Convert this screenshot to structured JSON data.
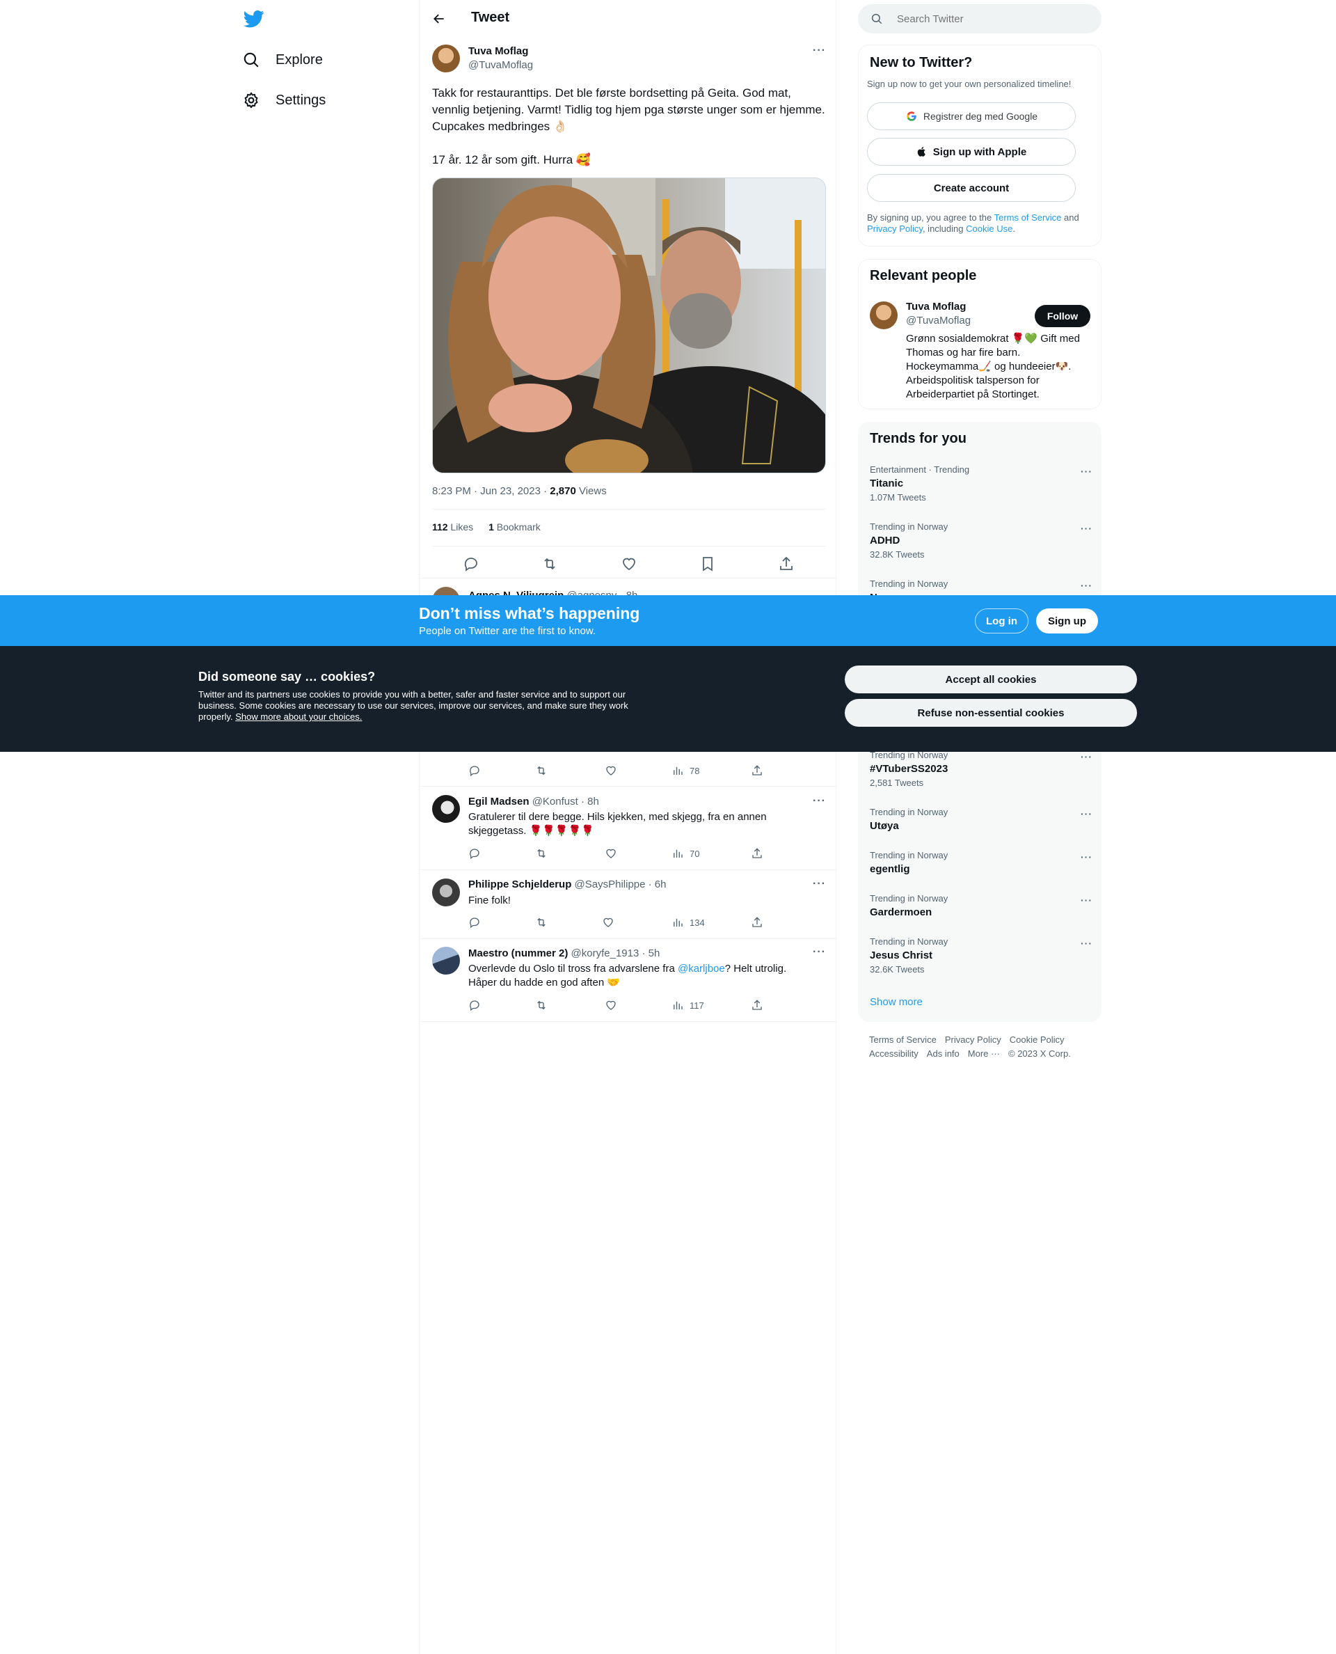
{
  "nav": {
    "explore": "Explore",
    "settings": "Settings"
  },
  "header": {
    "title": "Tweet"
  },
  "main_tweet": {
    "name": "Tuva Moflag",
    "handle": "@TuvaMoflag",
    "text": "Takk for restauranttips. Det ble første bordsetting på Geita. God mat, vennlig betjening. Varmt! Tidlig tog hjem pga største unger som er hjemme. Cupcakes medbringes 👌🏻\n\n17 år. 12 år som gift. Hurra 🥰",
    "time": "8:23 PM · Jun 23, 2023 · ",
    "views": "2,870",
    "views_label": " Views",
    "likes": "112",
    "likes_label": " Likes",
    "bookmarks": "1",
    "bookmarks_label": " Bookmark"
  },
  "partial_reply": {
    "name": "Agnes N. Viljugrein",
    "handle": "@agnesnv · 8h"
  },
  "replies": [
    {
      "name": "Egil Madsen",
      "meta": " @Konfust · 8h",
      "text": "Gratulerer til dere begge. Hils kjekken, med skjegg, fra en annen skjeggetass. 🌹🌹🌹🌹🌹",
      "views": "70"
    },
    {
      "name": "Philippe Schjelderup",
      "meta": " @SaysPhilippe · 6h",
      "text": "Fine folk!",
      "views": "134"
    },
    {
      "name": "Maestro (nummer 2)",
      "meta": " @koryfe_1913 · 5h",
      "text_a": "Overlevde du Oslo til tross fra advarslene fra ",
      "mention": "@karljboe",
      "text_b": "? Helt utrolig. Håper du hadde en god aften 🤝",
      "views": "117"
    }
  ],
  "hidden_reply_views": "78",
  "search": {
    "placeholder": "Search Twitter"
  },
  "signup": {
    "title": "New to Twitter?",
    "sub": "Sign up now to get your own personalized timeline!",
    "google": "Registrer deg med Google",
    "apple": "Sign up with Apple",
    "create": "Create account",
    "legal_a": "By signing up, you agree to the ",
    "tos": "Terms of Service",
    "legal_b": " and ",
    "privacy": "Privacy Policy",
    "legal_c": ", including ",
    "cookie": "Cookie Use",
    "legal_d": "."
  },
  "relevant": {
    "title": "Relevant people",
    "name": "Tuva Moflag",
    "handle": "@TuvaMoflag",
    "follow": "Follow",
    "bio": "Grønn sosialdemokrat 🌹💚 Gift med Thomas og har fire barn. Hockeymamma🏒 og hundeeier🐶. Arbeidspolitisk talsperson for Arbeiderpartiet på Stortinget."
  },
  "trends": {
    "title": "Trends for you",
    "items": [
      {
        "cat": "Entertainment · Trending",
        "name": "Titanic",
        "count": "1.07M Tweets"
      },
      {
        "cat": "Trending in Norway",
        "name": "ADHD",
        "count": "32.8K Tweets"
      },
      {
        "cat": "Trending in Norway",
        "name": "N",
        "count": ""
      },
      {
        "cat": "Trending in Norway",
        "name": "#VTuberSS2023",
        "count": "2,581 Tweets"
      },
      {
        "cat": "Trending in Norway",
        "name": "Utøya",
        "count": ""
      },
      {
        "cat": "Trending in Norway",
        "name": "egentlig",
        "count": ""
      },
      {
        "cat": "Trending in Norway",
        "name": "Gardermoen",
        "count": ""
      },
      {
        "cat": "Trending in Norway",
        "name": "Jesus Christ",
        "count": "32.6K Tweets"
      }
    ],
    "show_more": "Show more"
  },
  "footer": {
    "l1": [
      "Terms of Service",
      "Privacy Policy",
      "Cookie Policy"
    ],
    "l2": [
      "Accessibility",
      "Ads info",
      "More ···",
      "© 2023 X Corp."
    ]
  },
  "banner": {
    "title": "Don’t miss what’s happening",
    "sub": "People on Twitter are the first to know.",
    "login": "Log in",
    "signup": "Sign up"
  },
  "cookies": {
    "title": "Did someone say … cookies?",
    "text": "Twitter and its partners use cookies to provide you with a better, safer and faster service and to support our business. Some cookies are necessary to use our services, improve our services, and make sure they work properly. ",
    "link": "Show more about your choices.",
    "accept": "Accept all cookies",
    "refuse": "Refuse non-essential cookies"
  },
  "colors": {
    "accent": "#1d9bf0",
    "banner": "#1d9bf0",
    "cookie_bg": "#15202b"
  }
}
